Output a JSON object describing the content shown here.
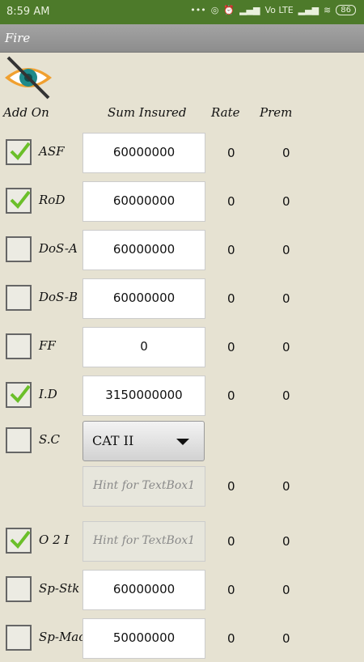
{
  "status_bar": {
    "time": "8:59 AM",
    "signal_text": "Vo LTE",
    "battery": "86"
  },
  "app_title": "Fire",
  "headers": {
    "add_on": "Add On",
    "sum_insured": "Sum Insured",
    "rate": "Rate",
    "prem": "Prem"
  },
  "rows": [
    {
      "label": "ASF",
      "checked": true,
      "sum": "60000000",
      "rate": "0",
      "prem": "0"
    },
    {
      "label": "RoD",
      "checked": true,
      "sum": "60000000",
      "rate": "0",
      "prem": "0"
    },
    {
      "label": "DoS-A",
      "checked": false,
      "sum": "60000000",
      "rate": "0",
      "prem": "0"
    },
    {
      "label": "DoS-B",
      "checked": false,
      "sum": "60000000",
      "rate": "0",
      "prem": "0"
    },
    {
      "label": "FF",
      "checked": false,
      "sum": "0",
      "rate": "0",
      "prem": "0"
    },
    {
      "label": "I.D",
      "checked": true,
      "sum": "3150000000",
      "rate": "0",
      "prem": "0"
    },
    {
      "label": "S.C",
      "checked": false,
      "dropdown": "CAT II"
    },
    {
      "label": "",
      "hint": "Hint for TextBox1",
      "rate": "0",
      "prem": "0"
    },
    {
      "label": "O 2 I",
      "checked": true,
      "hint": "Hint for TextBox1",
      "rate": "0",
      "prem": "0"
    },
    {
      "label": "Sp-Stk",
      "checked": false,
      "sum": "60000000",
      "rate": "0",
      "prem": "0"
    },
    {
      "label": "Sp-Mac",
      "checked": false,
      "sum": "50000000",
      "rate": "0",
      "prem": "0"
    }
  ],
  "colors": {
    "status_bar": "#4d7a2a",
    "background": "#e6e2d2",
    "title_bar": "#999999",
    "checkmark": "#6bbf2a"
  }
}
